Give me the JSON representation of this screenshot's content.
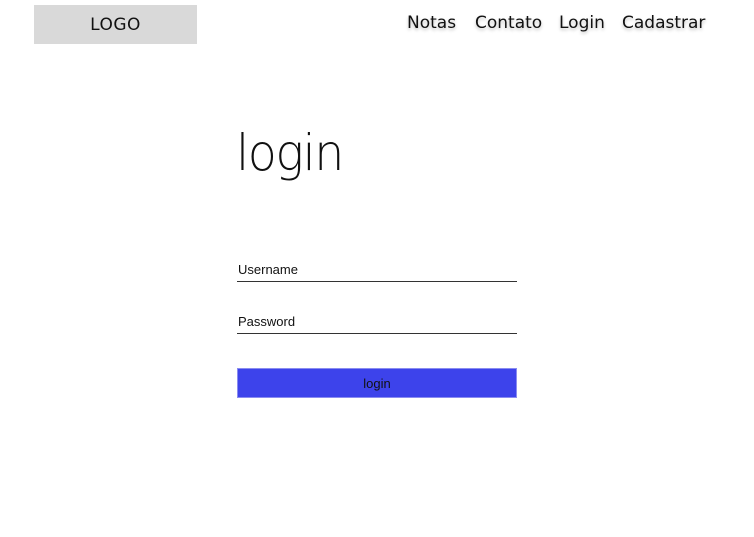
{
  "header": {
    "logo_text": "LOGO",
    "nav": [
      {
        "label": "Notas"
      },
      {
        "label": "Contato"
      },
      {
        "label": "Login"
      },
      {
        "label": "Cadastrar"
      }
    ]
  },
  "main": {
    "title": "login",
    "username": {
      "placeholder": "Username",
      "value": ""
    },
    "password": {
      "placeholder": "Password",
      "value": ""
    },
    "submit_label": "login"
  },
  "colors": {
    "logo_background": "#d9d9d9",
    "button_background": "#3d43eb"
  }
}
